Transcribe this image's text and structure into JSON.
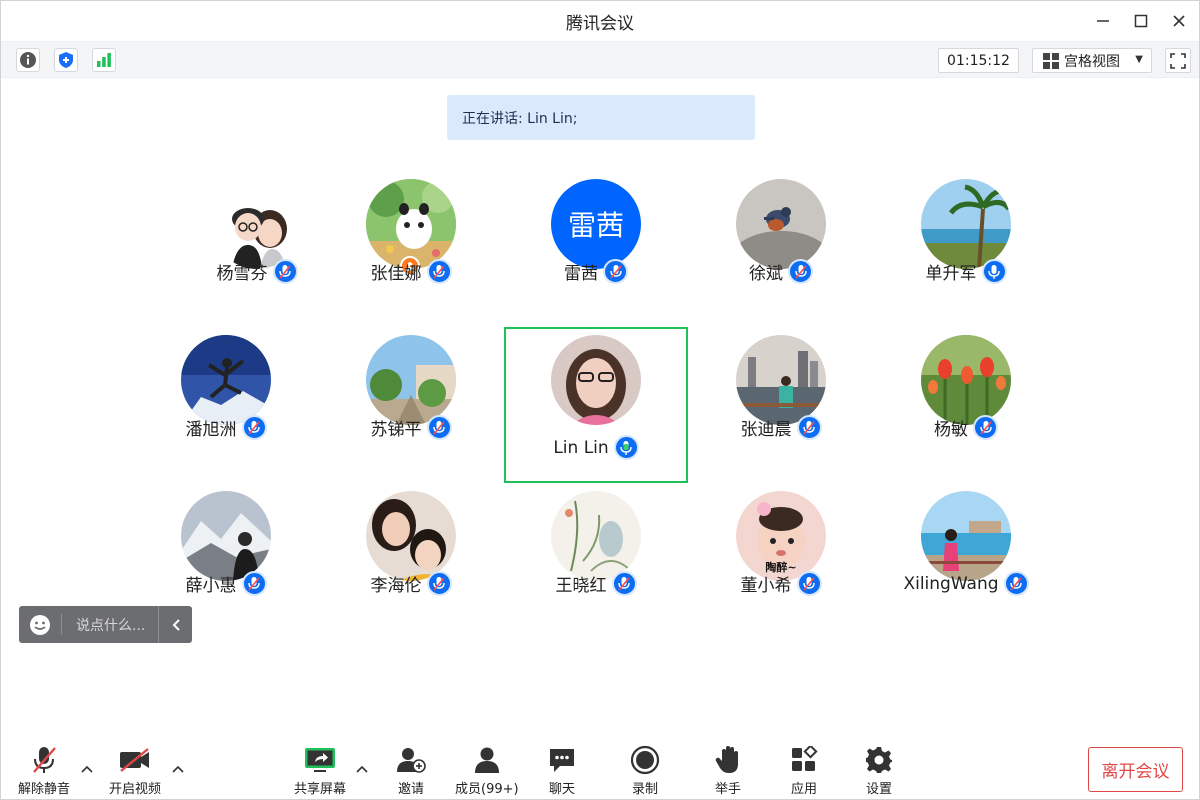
{
  "window": {
    "title": "腾讯会议"
  },
  "toolbar": {
    "timer": "01:15:12",
    "view_label": "宫格视图"
  },
  "speaking": {
    "text": "正在讲话: Lin Lin;"
  },
  "participants": [
    {
      "name": "杨雪芬",
      "avatar": "cartoon-couple",
      "mic": "muted"
    },
    {
      "name": "张佳娜",
      "avatar": "cartoon-panda",
      "mic": "muted",
      "host": true
    },
    {
      "name": "雷茜",
      "avatar_text": "雷茜",
      "mic": "muted"
    },
    {
      "name": "徐斌",
      "avatar": "bird-photo",
      "mic": "muted"
    },
    {
      "name": "单升军",
      "avatar": "palm-beach-photo",
      "mic": "on"
    },
    {
      "name": "潘旭洲",
      "avatar": "mountain-jump-photo",
      "mic": "muted"
    },
    {
      "name": "苏锑平",
      "avatar": "street-trees-photo",
      "mic": "muted"
    },
    {
      "name": "Lin Lin",
      "avatar": "woman-glasses-photo",
      "mic": "speaking",
      "active": true
    },
    {
      "name": "张迪晨",
      "avatar": "city-waterfront-photo",
      "mic": "muted"
    },
    {
      "name": "杨敏",
      "avatar": "tulips-photo",
      "mic": "muted"
    },
    {
      "name": "薛小惠",
      "avatar": "snow-mountain-photo",
      "mic": "muted"
    },
    {
      "name": "李海伦",
      "avatar": "mother-child-photo",
      "mic": "muted"
    },
    {
      "name": "王晓红",
      "avatar": "ink-painting",
      "mic": "muted"
    },
    {
      "name": "董小希",
      "avatar": "baby-photo",
      "avatar_caption": "陶醉~",
      "mic": "muted"
    },
    {
      "name": "XilingWang",
      "avatar": "seaside-photo",
      "mic": "muted"
    }
  ],
  "chat": {
    "placeholder": "说点什么..."
  },
  "bottombar": {
    "unmute": "解除静音",
    "start_video": "开启视频",
    "share_screen": "共享屏幕",
    "invite": "邀请",
    "members": "成员(99+)",
    "chat": "聊天",
    "record": "录制",
    "raise_hand": "举手",
    "apps": "应用",
    "settings": "设置",
    "leave": "离开会议"
  },
  "colors": {
    "accent": "#0c6cf2",
    "active_border": "#1fc05a",
    "leave": "#e04848",
    "speaking_bg": "#dbe9fd"
  }
}
